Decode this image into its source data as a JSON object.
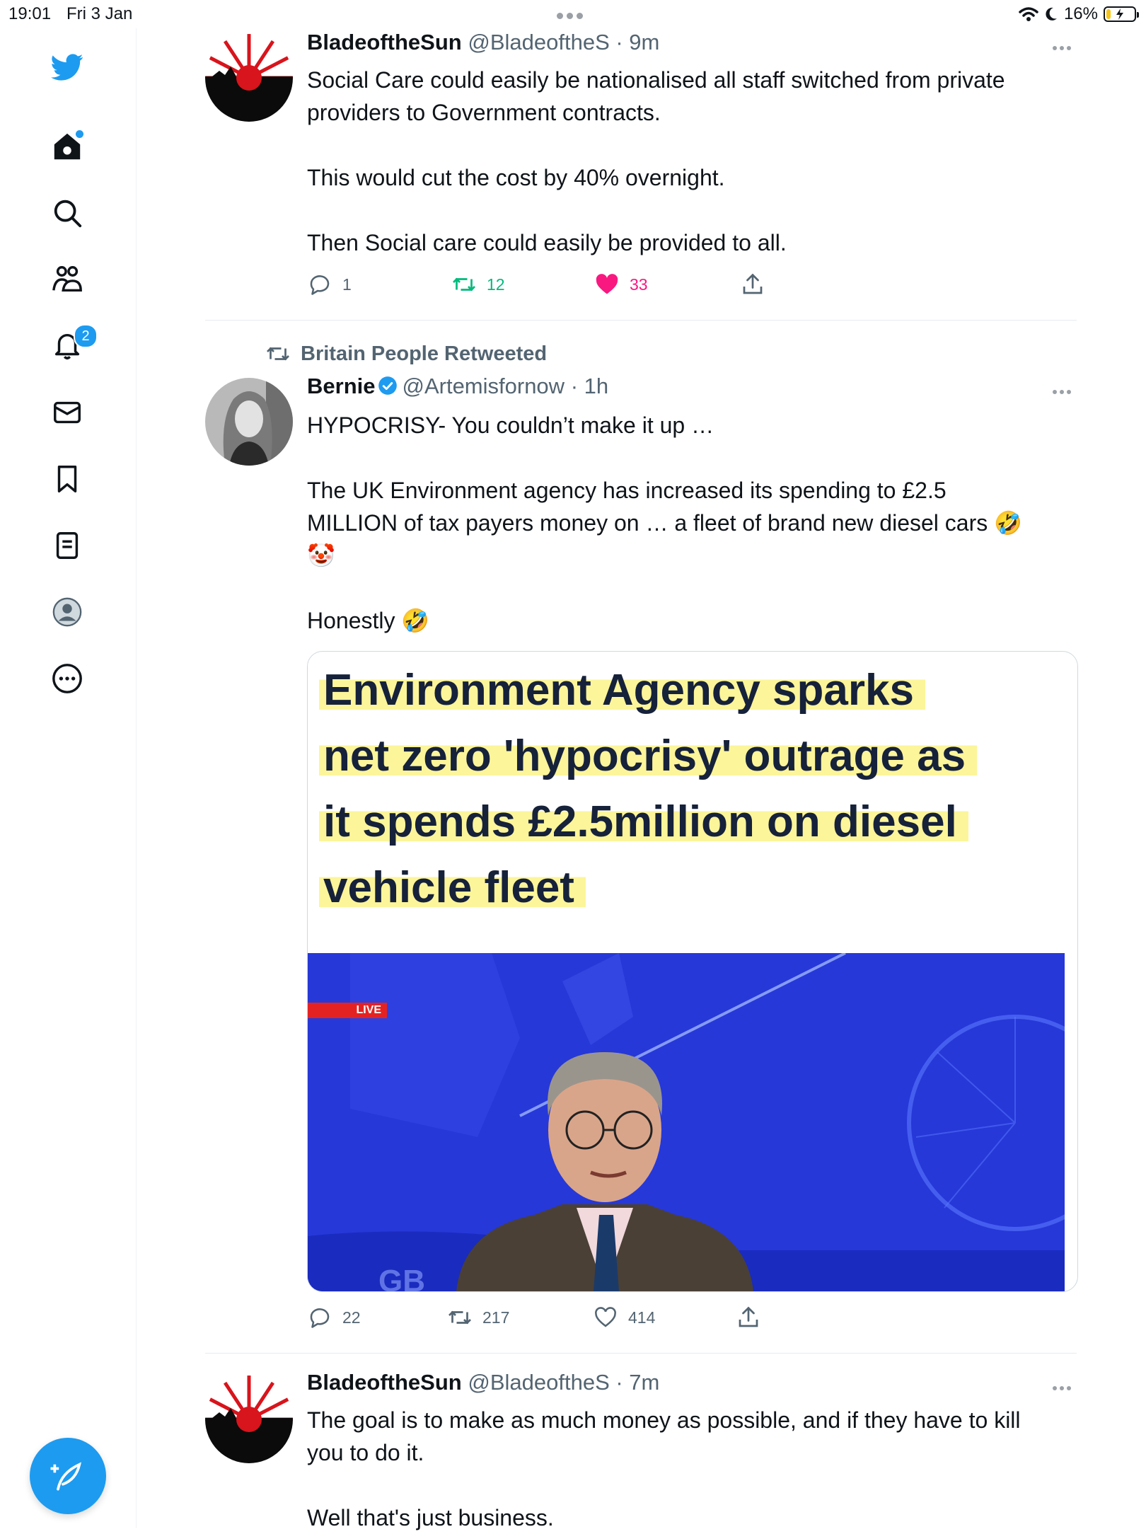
{
  "status_bar": {
    "time": "19:01",
    "date": "Fri 3 Jan",
    "battery": "16%",
    "battery_level": 0.16
  },
  "sidebar": {
    "items": [
      "twitter-logo",
      "home",
      "search",
      "communities",
      "notifications",
      "messages",
      "bookmarks",
      "lists",
      "profile",
      "more"
    ],
    "notification_count": "2"
  },
  "tweets": [
    {
      "name": "BladeoftheSun",
      "handle": "@BladeoftheS",
      "time": "· 9m",
      "body": [
        "Social Care could easily be nationalised all staff switched from private",
        "providers to Government contracts.",
        "",
        "This would cut the cost by 40% overnight.",
        "",
        "Then Social care could easily be provided to all."
      ],
      "replies": "1",
      "retweets": "12",
      "likes": "33",
      "liked": true,
      "retweeted": true
    },
    {
      "retweeted_by": "Britain People Retweeted",
      "name": "Bernie",
      "handle": "@Artemisfornow",
      "time": "· 1h",
      "verified": true,
      "body": [
        "HYPOCRISY- You couldn’t make it up …",
        "",
        "The UK Environment agency has increased its spending to £2.5",
        "MILLION of tax payers money on … a fleet of brand new diesel cars 🤣",
        "🤡",
        "",
        "Honestly 🤣"
      ],
      "media": {
        "headline": [
          "Environment Agency sparks",
          "net zero 'hypocrisy' outrage as",
          "it spends £2.5million on diesel",
          "vehicle fleet"
        ],
        "live_label": "LIVE",
        "channel_text": "GB"
      },
      "replies": "22",
      "retweets": "217",
      "likes": "414"
    },
    {
      "name": "BladeoftheSun",
      "handle": "@BladeoftheS",
      "time": "· 7m",
      "body": [
        "The goal is to make as much money as possible, and if they have to kill",
        "you to do it.",
        "",
        "Well that's just business."
      ]
    }
  ],
  "colors": {
    "accent": "#1d9bf0",
    "retweet_green": "#00ba7c",
    "like_pink": "#f91880",
    "secondary_text": "#536471"
  }
}
